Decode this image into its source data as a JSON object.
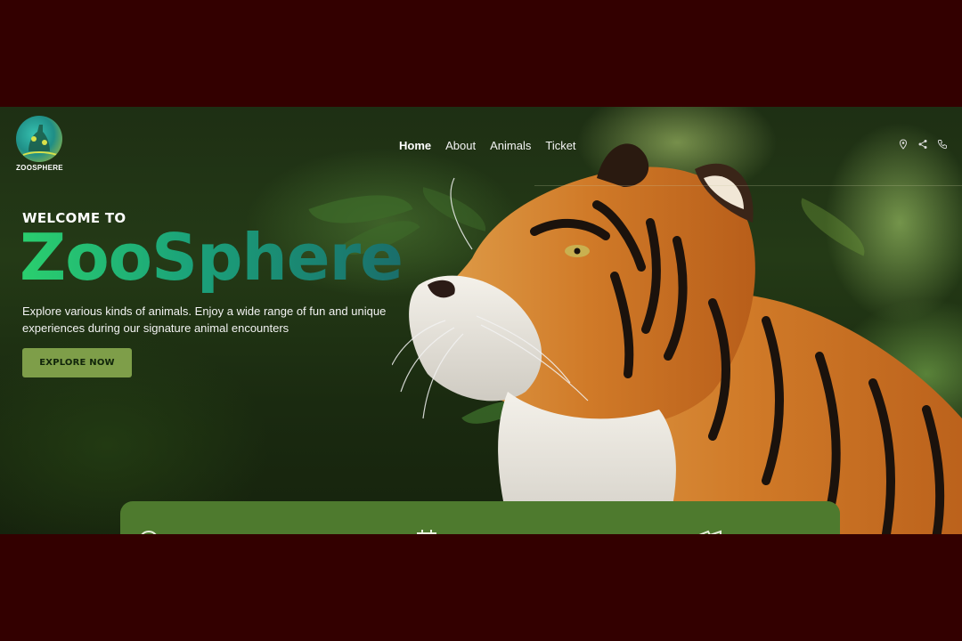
{
  "header": {
    "logo_text": "ZOOSPHERE",
    "nav": [
      "Home",
      "About",
      "Animals",
      "Ticket"
    ],
    "active_nav": "Home",
    "icons": [
      "location-icon",
      "share-icon",
      "phone-icon"
    ]
  },
  "hero": {
    "welcome": "WELCOME TO",
    "brand": "ZooSphere",
    "description": "Explore various kinds of animals. Enjoy a wide range of fun and unique experiences during our signature animal encounters",
    "cta_label": "EXPLORE NOW"
  },
  "info_bar": {
    "icons": [
      "clock-icon",
      "calendar-icon",
      "ticket-icon"
    ]
  },
  "colors": {
    "frame": "#330000",
    "brand_gradient_start": "#2acf6e",
    "brand_gradient_end": "#1a6e6b",
    "cta": "#7e9e49",
    "info_bar": "#4e7a2e"
  }
}
